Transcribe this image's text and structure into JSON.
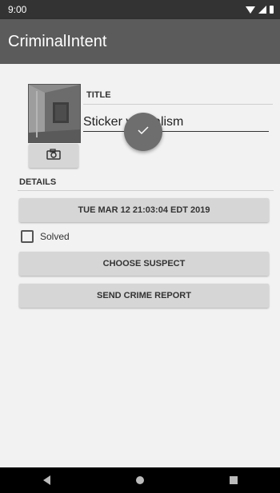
{
  "status_bar": {
    "time": "9:00",
    "icons": [
      "wifi-icon",
      "signal-icon",
      "battery-icon"
    ]
  },
  "app_bar": {
    "title": "CriminalIntent"
  },
  "crime": {
    "title_label": "TITLE",
    "title_value": "Sticker vandalism",
    "details_label": "DETAILS",
    "date_button": "TUE MAR 12 21:03:04 EDT 2019",
    "solved_label": "Solved",
    "solved": false,
    "choose_suspect": "CHOOSE SUSPECT",
    "send_report": "SEND CRIME REPORT"
  },
  "icons": {
    "camera": "camera-icon",
    "fab": "check-icon"
  },
  "nav_bar": {
    "buttons": [
      "back-icon",
      "home-icon",
      "recents-icon"
    ]
  },
  "colors": {
    "app_bar": "#5b5b5b",
    "status_bar": "#333333",
    "fab": "#6e6e6e",
    "button": "#d6d6d6"
  }
}
